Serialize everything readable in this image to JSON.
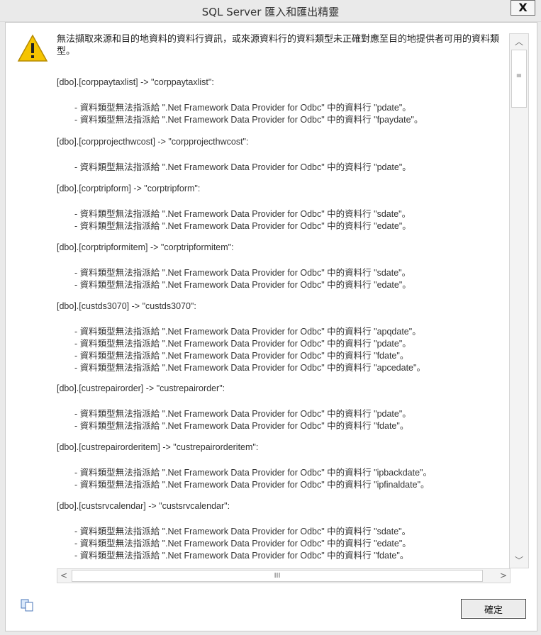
{
  "window": {
    "title": "SQL Server 匯入和匯出精靈",
    "close_label": "X"
  },
  "dialog": {
    "headline": "無法擷取來源和目的地資料的資料行資訊，或來源資料行的資料類型未正確對應至目的地提供者可用的資料類型。",
    "ok_label": "確定",
    "icons": {
      "warning": "warning-triangle-icon",
      "copy": "copy-icon"
    },
    "groups": [
      {
        "table": "[dbo].[corppaytaxlist] -> \"corppaytaxlist\":",
        "issues": [
          "- 資料類型無法指派給 \".Net Framework Data Provider for Odbc\" 中的資料行 \"pdate\"。",
          "- 資料類型無法指派給 \".Net Framework Data Provider for Odbc\" 中的資料行 \"fpaydate\"。"
        ]
      },
      {
        "table": "[dbo].[corpprojecthwcost] -> \"corpprojecthwcost\":",
        "issues": [
          "- 資料類型無法指派給 \".Net Framework Data Provider for Odbc\" 中的資料行 \"pdate\"。"
        ]
      },
      {
        "table": "[dbo].[corptripform] -> \"corptripform\":",
        "issues": [
          "- 資料類型無法指派給 \".Net Framework Data Provider for Odbc\" 中的資料行 \"sdate\"。",
          "- 資料類型無法指派給 \".Net Framework Data Provider for Odbc\" 中的資料行 \"edate\"。"
        ]
      },
      {
        "table": "[dbo].[corptripformitem] -> \"corptripformitem\":",
        "issues": [
          "- 資料類型無法指派給 \".Net Framework Data Provider for Odbc\" 中的資料行 \"sdate\"。",
          "- 資料類型無法指派給 \".Net Framework Data Provider for Odbc\" 中的資料行 \"edate\"。"
        ]
      },
      {
        "table": "[dbo].[custds3070] -> \"custds3070\":",
        "issues": [
          "- 資料類型無法指派給 \".Net Framework Data Provider for Odbc\" 中的資料行 \"apqdate\"。",
          "- 資料類型無法指派給 \".Net Framework Data Provider for Odbc\" 中的資料行 \"pdate\"。",
          "- 資料類型無法指派給 \".Net Framework Data Provider for Odbc\" 中的資料行 \"fdate\"。",
          "- 資料類型無法指派給 \".Net Framework Data Provider for Odbc\" 中的資料行 \"apcedate\"。"
        ]
      },
      {
        "table": "[dbo].[custrepairorder] -> \"custrepairorder\":",
        "issues": [
          "- 資料類型無法指派給 \".Net Framework Data Provider for Odbc\" 中的資料行 \"pdate\"。",
          "- 資料類型無法指派給 \".Net Framework Data Provider for Odbc\" 中的資料行 \"fdate\"。"
        ]
      },
      {
        "table": "[dbo].[custrepairorderitem] -> \"custrepairorderitem\":",
        "issues": [
          "- 資料類型無法指派給 \".Net Framework Data Provider for Odbc\" 中的資料行 \"ipbackdate\"。",
          "- 資料類型無法指派給 \".Net Framework Data Provider for Odbc\" 中的資料行 \"ipfinaldate\"。"
        ]
      },
      {
        "table": "[dbo].[custsrvcalendar] -> \"custsrvcalendar\":",
        "issues": [
          "- 資料類型無法指派給 \".Net Framework Data Provider for Odbc\" 中的資料行 \"sdate\"。",
          "- 資料類型無法指派給 \".Net Framework Data Provider for Odbc\" 中的資料行 \"edate\"。",
          "- 資料類型無法指派給 \".Net Framework Data Provider for Odbc\" 中的資料行 \"fdate\"。"
        ]
      }
    ]
  },
  "scrollbars": {
    "vertical": {
      "up": "up-arrow-icon",
      "down": "down-arrow-icon",
      "grip": "≡"
    },
    "horizontal": {
      "left": "left-arrow-icon",
      "right": "right-arrow-icon",
      "grip": "III"
    }
  }
}
